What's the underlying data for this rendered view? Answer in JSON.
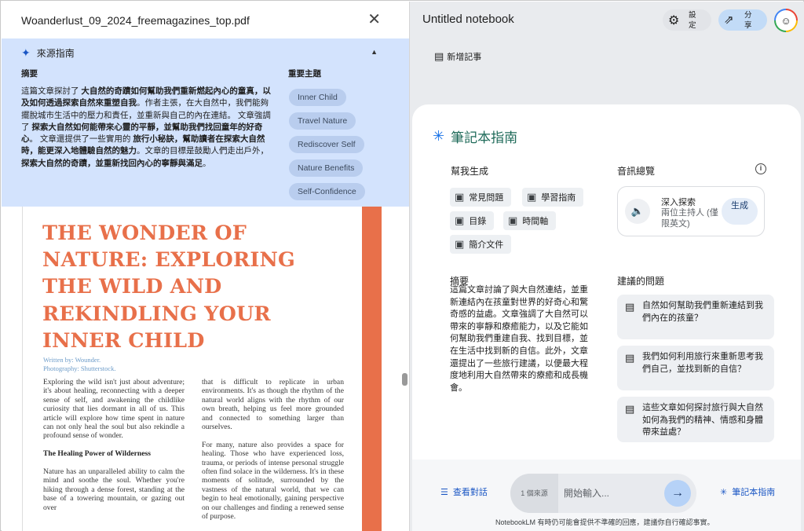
{
  "left": {
    "doc_title": "Woanderlust_09_2024_freemagazines_top.pdf",
    "source_guide": {
      "title": "來源指南",
      "summary_label": "摘要",
      "summary_segments": [
        {
          "t": "這篇文章探討了 ",
          "b": false
        },
        {
          "t": "大自然的奇蹟如何幫助我們重新燃起內心的童真，以及如何透過探索自然來重塑自我",
          "b": true
        },
        {
          "t": "。作者主張，在大自然中，我們能夠擺脫城市生活中的壓力和責任，並重新與自己的內在連結。 文章強調了 ",
          "b": false
        },
        {
          "t": "探索大自然如何能帶來心靈的平靜，並幫助我們找回童年的好奇心",
          "b": true
        },
        {
          "t": "。 文章還提供了一些實用的 ",
          "b": false
        },
        {
          "t": "旅行小秘訣，幫助讀者在探索大自然時，能更深入地體驗自然的魅力",
          "b": true
        },
        {
          "t": "。文章的目標是鼓勵人們走出戶外， ",
          "b": false
        },
        {
          "t": "探索大自然的奇蹟，並重新找回內心的寧靜與滿足",
          "b": true
        },
        {
          "t": "。",
          "b": false
        }
      ],
      "topics_label": "重要主題",
      "topics": [
        "Inner Child",
        "Travel Nature",
        "Rediscover Self",
        "Nature Benefits",
        "Self-Confidence"
      ]
    },
    "article": {
      "headline": "THE WONDER OF NATURE: EXPLORING THE WILD AND REKINDLING YOUR INNER CHILD",
      "writer": "Written by: Wounder.",
      "photo": "Photography: Shutterstock.",
      "col1_p1": "Exploring the wild isn't just about adventure; it's about healing, reconnecting with a deeper sense of self, and awakening the childlike curiosity that lies dormant in all of us. This article will explore how time spent in nature can not only heal the soul but also rekindle a profound sense of wonder.",
      "col1_sub": "The Healing Power of Wilderness",
      "col1_p2": "Nature has an unparalleled ability to calm the mind and soothe the soul. Whether you're hiking through a dense forest, standing at the base of a towering mountain, or gazing out over",
      "col2_p1": "that is difficult to replicate in urban environments. It's as though the rhythm of the natural world aligns with the rhythm of our own breath, helping us feel more grounded and connected to something larger than ourselves.",
      "col2_p2": "For many, nature also provides a space for healing. Those who have experienced loss, trauma, or periods of intense personal struggle often find solace in the wilderness. It's in these moments of solitude, surrounded by the vastness of the natural world, that we can begin to heal emotionally, gaining perspective on our challenges and finding a renewed sense of purpose."
    }
  },
  "right": {
    "notebook_title": "Untitled notebook",
    "settings_label": "設定",
    "share_label": "分享",
    "add_note": "新增記事",
    "guide_title": "筆記本指南",
    "help_label": "幫我生成",
    "help_buttons": [
      "常見問題",
      "學習指南",
      "目錄",
      "時間軸",
      "簡介文件"
    ],
    "audio_label": "音訊總覽",
    "audio_title": "深入探索",
    "audio_sub": "兩位主持人 (僅限英文)",
    "audio_generate": "生成",
    "summary_label": "摘要",
    "summary_text": "這篇文章討論了與大自然連結，並重新連結內在孩童對世界的好奇心和驚奇感的益處。文章強調了大自然可以帶來的寧靜和療癒能力，以及它能如何幫助我們重建自我、找到目標，並在生活中找到新的自信。此外，文章還提出了一些旅行建議，以便最大程度地利用大自然帶來的療癒和成長機會。",
    "suggested_label": "建議的問題",
    "questions": [
      "自然如何幫助我們重新連結到我們內在的孩童？",
      "我們如何利用旅行來重新思考我們自己，並找到新的自信？",
      "這些文章如何探討旅行與大自然如何為我們的精神、情感和身體帶來益處？"
    ],
    "view_chat": "查看對話",
    "source_count": "1 個來源",
    "input_placeholder": "開始輸入...",
    "guide_button": "筆記本指南",
    "disclaimer": "NotebookLM 有時仍可能會提供不準確的回應，建議你自行確認事實。"
  }
}
